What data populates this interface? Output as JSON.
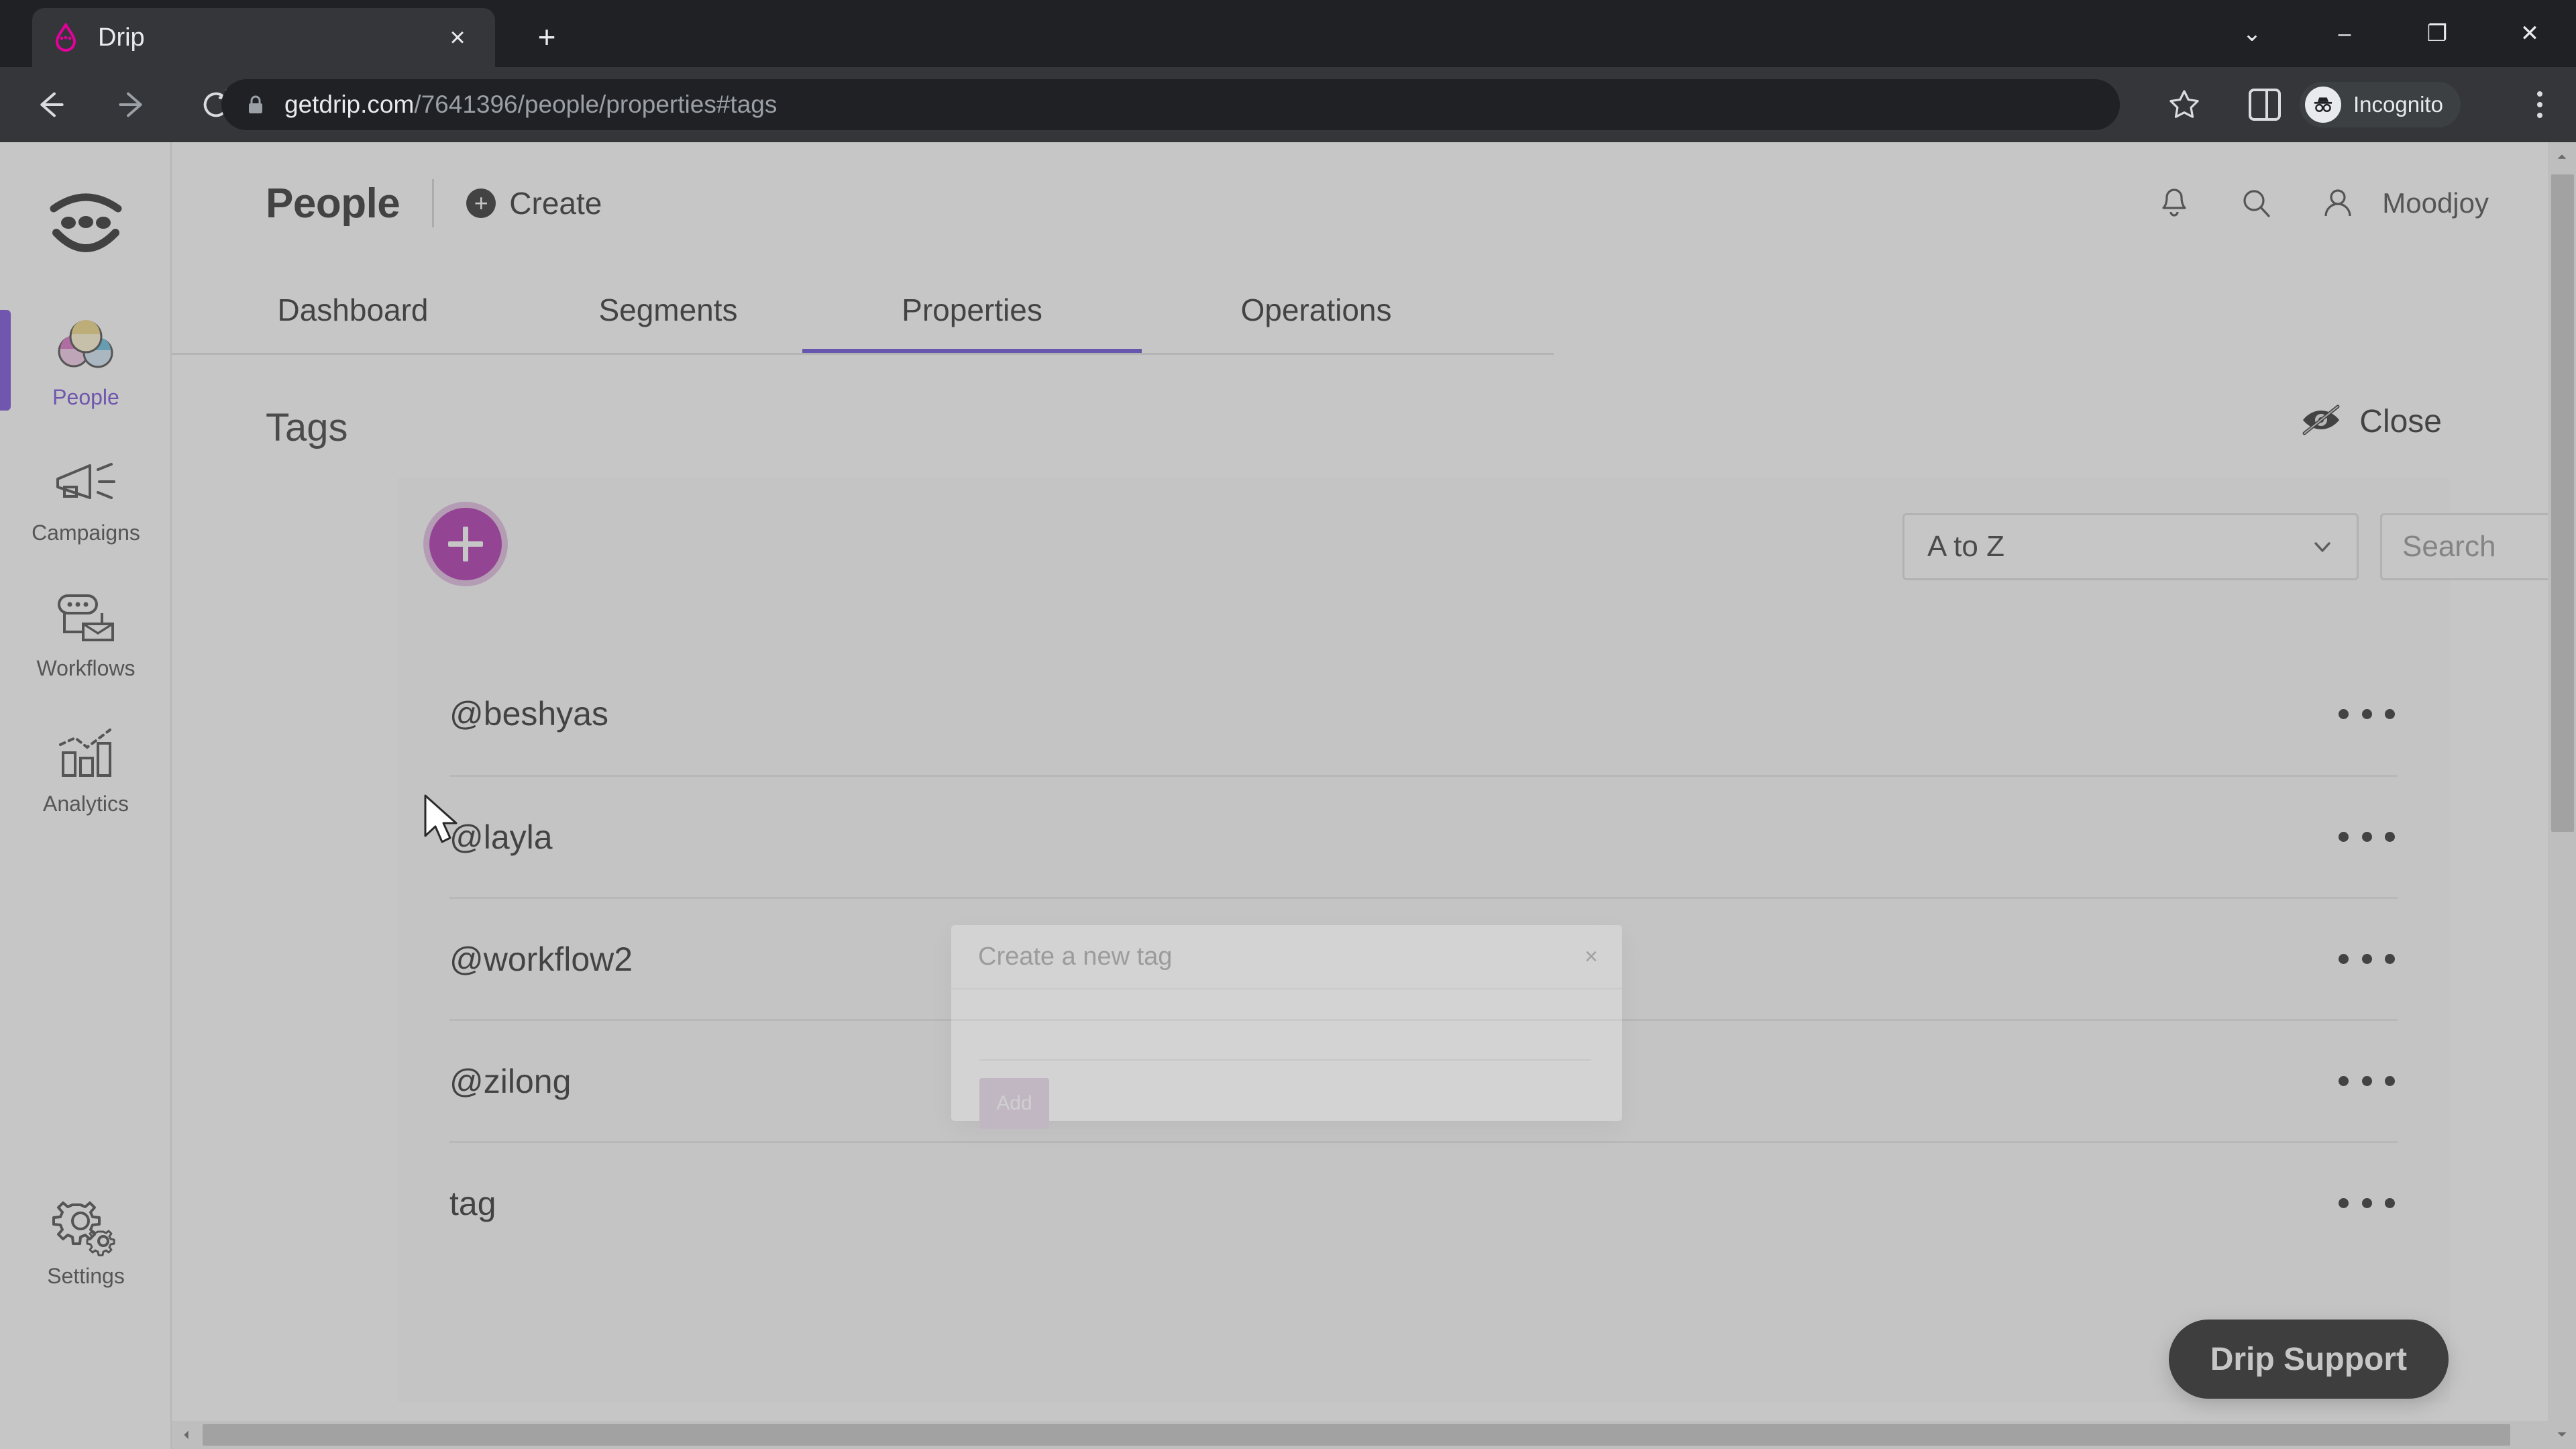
{
  "browser": {
    "tab": {
      "title": "Drip",
      "favicon": "drip-logo-icon",
      "close_label": "×"
    },
    "new_tab_label": "+",
    "window_controls": [
      {
        "name": "minimize-to-tray-button",
        "glyph": "⌄"
      },
      {
        "name": "minimize-button",
        "glyph": "–"
      },
      {
        "name": "maximize-button",
        "glyph": "❐"
      },
      {
        "name": "close-window-button",
        "glyph": "✕"
      }
    ],
    "nav": {
      "back": "←",
      "forward": "→",
      "reload": "⟳"
    },
    "url": {
      "host": "getdrip.com",
      "path": "/7641396/people/properties#tags"
    },
    "profile_label": "Incognito",
    "bookmark_icon": "star-icon",
    "side_panel_icon": "side-panel-icon",
    "menu_icon": "chrome-menu-icon"
  },
  "sidebar": {
    "logo": "drip-logo",
    "items": [
      {
        "label": "People",
        "icon": "people-icon",
        "active": true
      },
      {
        "label": "Campaigns",
        "icon": "megaphone-icon",
        "active": false
      },
      {
        "label": "Workflows",
        "icon": "workflow-icon",
        "active": false
      },
      {
        "label": "Analytics",
        "icon": "bar-chart-icon",
        "active": false
      },
      {
        "label": "Settings",
        "icon": "gear-icon",
        "active": false
      }
    ]
  },
  "header": {
    "title": "People",
    "create_label": "Create",
    "create_icon": "plus-circle-icon",
    "notifications_icon": "bell-icon",
    "search_icon": "search-icon",
    "account_icon": "user-icon",
    "account_label": "Moodjoy"
  },
  "tabs": [
    {
      "label": "Dashboard",
      "active": false
    },
    {
      "label": "Segments",
      "active": false
    },
    {
      "label": "Properties",
      "active": true
    },
    {
      "label": "Operations",
      "active": false
    }
  ],
  "content": {
    "heading": "Tags",
    "close_label": "Close",
    "close_icon": "eye-off-icon",
    "add_tag_icon": "plus-icon",
    "sort": {
      "value": "A to Z",
      "caret_icon": "chevron-down-icon"
    },
    "search": {
      "value": "",
      "placeholder": "Search"
    },
    "row_menu_icon": "ellipsis-icon",
    "tags": [
      {
        "name": "@beshyas"
      },
      {
        "name": "@layla"
      },
      {
        "name": "@workflow2"
      },
      {
        "name": "@zilong"
      },
      {
        "name": "tag"
      }
    ]
  },
  "support": {
    "label": "Drip Support"
  },
  "modal": {
    "title": "Create a new tag",
    "close_glyph": "×",
    "input_value": "",
    "input_placeholder": "",
    "add_label": "Add"
  },
  "colors": {
    "accent_purple": "#6c3fd6",
    "tab_underline": "#5b3fd4",
    "add_button_magenta": "#a71fa7",
    "modal_add_button": "#b993c0",
    "support_button": "#151515"
  }
}
